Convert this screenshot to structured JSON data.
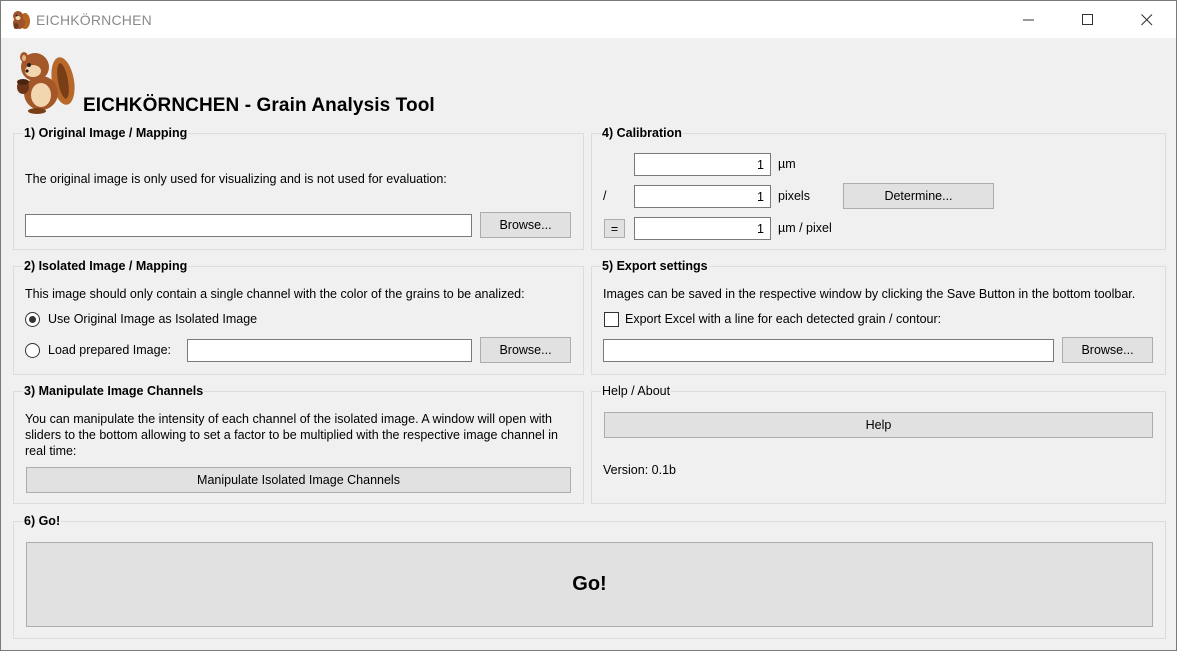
{
  "window": {
    "title": "EICHKÖRNCHEN",
    "minimize_icon": "minimize-icon",
    "maximize_icon": "maximize-icon",
    "close_icon": "close-icon"
  },
  "app": {
    "heading": "EICHKÖRNCHEN - Grain Analysis Tool",
    "logo_icon": "chipmunk-icon"
  },
  "original": {
    "title": "1) Original Image / Mapping",
    "description": "The original image is only used for visualizing and is not used for evaluation:",
    "path_value": "",
    "browse_label": "Browse..."
  },
  "isolated": {
    "title": "2) Isolated Image / Mapping",
    "description": "This image should only contain a single channel with the color of the grains to be analized:",
    "option_use_original": "Use Original Image as Isolated Image",
    "option_load_prepared": "Load prepared Image:",
    "selected_option": "use_original",
    "path_value": "",
    "browse_label": "Browse..."
  },
  "channels": {
    "title": "3) Manipulate Image Channels",
    "description": "You can manipulate the intensity of each channel of the isolated image. A window will open with sliders to the bottom allowing to set a factor to be multiplied with the respective image channel in real time:",
    "button_label": "Manipulate Isolated Image Channels"
  },
  "calibration": {
    "title": "4) Calibration",
    "micrometer_value": "1",
    "micrometer_unit": "µm",
    "divide_symbol": "/",
    "pixels_value": "1",
    "pixels_unit": "pixels",
    "determine_label": "Determine...",
    "equals_label": "=",
    "result_value": "1",
    "result_unit": "µm / pixel"
  },
  "export": {
    "title": "5) Export settings",
    "description": "Images can be saved in the respective window by clicking the Save Button in the bottom toolbar.",
    "excel_label": "Export Excel with a line for each detected grain / contour:",
    "excel_checked": false,
    "path_value": "",
    "browse_label": "Browse..."
  },
  "help": {
    "title": "Help / About",
    "button_label": "Help",
    "version_text": "Version: 0.1b"
  },
  "go": {
    "title": "6) Go!",
    "button_label": "Go!"
  }
}
